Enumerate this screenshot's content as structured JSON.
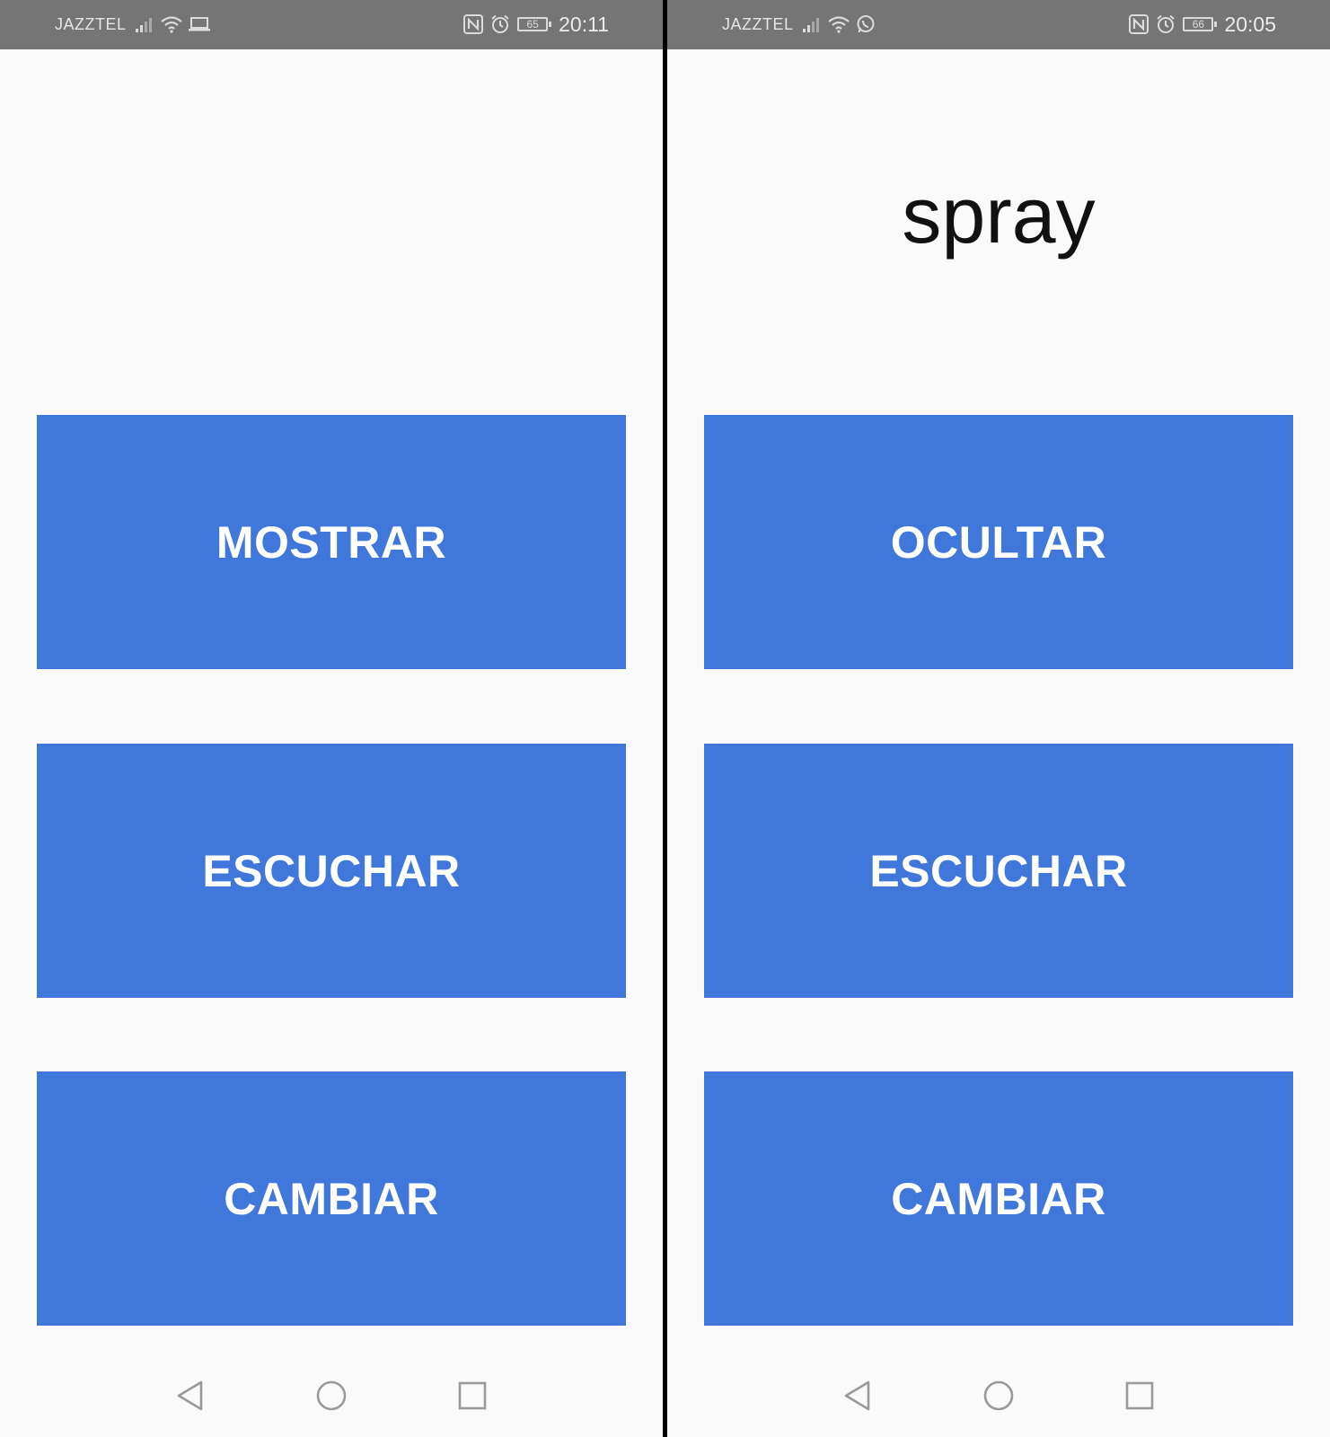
{
  "colors": {
    "status_bar": "#757575",
    "background": "#fafafa",
    "button": "#4077db",
    "button_text": "#ffffff",
    "divider": "#000000"
  },
  "screens": [
    {
      "status": {
        "carrier": "JAZZTEL",
        "battery": "65",
        "time": "20:11",
        "extra_icon": "laptop-icon"
      },
      "word": "",
      "buttons": [
        "MOSTRAR",
        "ESCUCHAR",
        "CAMBIAR"
      ]
    },
    {
      "status": {
        "carrier": "JAZZTEL",
        "battery": "66",
        "time": "20:05",
        "extra_icon": "whatsapp-icon"
      },
      "word": "spray",
      "buttons": [
        "OCULTAR",
        "ESCUCHAR",
        "CAMBIAR"
      ]
    }
  ],
  "nav": [
    "back-icon",
    "home-icon",
    "recents-icon"
  ]
}
